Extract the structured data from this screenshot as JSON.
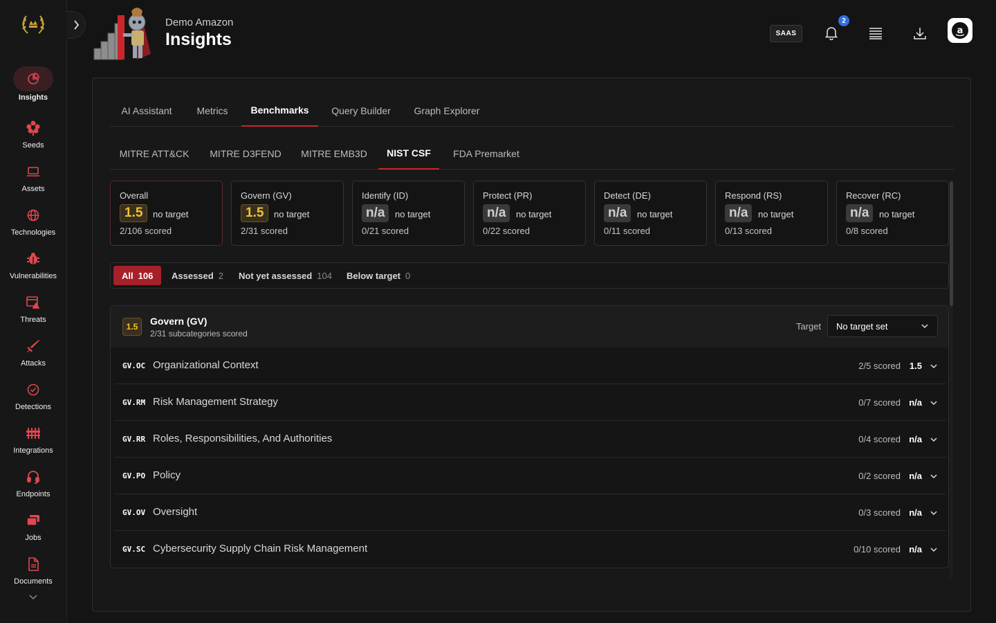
{
  "header": {
    "org_name": "Demo Amazon",
    "page_title": "Insights",
    "saas_badge": "SAAS",
    "notification_count": "2"
  },
  "sidebar": {
    "items": [
      {
        "label": "Insights",
        "icon": "pie-chart-icon",
        "active": true
      },
      {
        "label": "Seeds",
        "icon": "seed-flower-icon"
      },
      {
        "label": "Assets",
        "icon": "laptop-icon"
      },
      {
        "label": "Technologies",
        "icon": "globe-icon"
      },
      {
        "label": "Vulnerabilities",
        "icon": "bug-icon"
      },
      {
        "label": "Threats",
        "icon": "threat-window-icon"
      },
      {
        "label": "Attacks",
        "icon": "sword-icon"
      },
      {
        "label": "Detections",
        "icon": "check-circle-icon"
      },
      {
        "label": "Integrations",
        "icon": "sliders-icon"
      },
      {
        "label": "Endpoints",
        "icon": "headset-icon"
      },
      {
        "label": "Jobs",
        "icon": "stack-icon"
      },
      {
        "label": "Documents",
        "icon": "document-icon"
      }
    ]
  },
  "tabs_primary": [
    {
      "label": "AI Assistant"
    },
    {
      "label": "Metrics"
    },
    {
      "label": "Benchmarks",
      "active": true
    },
    {
      "label": "Query Builder"
    },
    {
      "label": "Graph Explorer"
    }
  ],
  "tabs_secondary": [
    {
      "label": "MITRE ATT&CK"
    },
    {
      "label": "MITRE D3FEND"
    },
    {
      "label": "MITRE EMB3D"
    },
    {
      "label": "NIST CSF",
      "active": true
    },
    {
      "label": "FDA Premarket"
    }
  ],
  "score_cards": [
    {
      "title": "Overall",
      "score": "1.5",
      "target": "no target",
      "scored": "2/106 scored",
      "selected": true
    },
    {
      "title": "Govern (GV)",
      "score": "1.5",
      "target": "no target",
      "scored": "2/31 scored"
    },
    {
      "title": "Identify (ID)",
      "score": "n/a",
      "target": "no target",
      "scored": "0/21 scored"
    },
    {
      "title": "Protect (PR)",
      "score": "n/a",
      "target": "no target",
      "scored": "0/22 scored"
    },
    {
      "title": "Detect (DE)",
      "score": "n/a",
      "target": "no target",
      "scored": "0/11 scored"
    },
    {
      "title": "Respond (RS)",
      "score": "n/a",
      "target": "no target",
      "scored": "0/13 scored"
    },
    {
      "title": "Recover (RC)",
      "score": "n/a",
      "target": "no target",
      "scored": "0/8 scored"
    }
  ],
  "filters": [
    {
      "label": "All",
      "count": "106",
      "active": true
    },
    {
      "label": "Assessed",
      "count": "2"
    },
    {
      "label": "Not yet assessed",
      "count": "104"
    },
    {
      "label": "Below target",
      "count": "0"
    }
  ],
  "category": {
    "badge": "1.5",
    "name": "Govern (GV)",
    "subtitle": "2/31 subcategories scored",
    "target_label": "Target",
    "target_value": "No target set",
    "rows": [
      {
        "code": "GV.OC",
        "name": "Organizational Context",
        "scored": "2/5 scored",
        "score": "1.5"
      },
      {
        "code": "GV.RM",
        "name": "Risk Management Strategy",
        "scored": "0/7 scored",
        "score": "n/a"
      },
      {
        "code": "GV.RR",
        "name": "Roles, Responsibilities, And Authorities",
        "scored": "0/4 scored",
        "score": "n/a"
      },
      {
        "code": "GV.PO",
        "name": "Policy",
        "scored": "0/2 scored",
        "score": "n/a"
      },
      {
        "code": "GV.OV",
        "name": "Oversight",
        "scored": "0/3 scored",
        "score": "n/a"
      },
      {
        "code": "GV.SC",
        "name": "Cybersecurity Supply Chain Risk Management",
        "scored": "0/10 scored",
        "score": "n/a"
      }
    ]
  },
  "colors": {
    "accent": "#c9262d",
    "active_chip": "#a6202a",
    "score_gold": "#f1c232",
    "notification": "#2f6fe0"
  }
}
